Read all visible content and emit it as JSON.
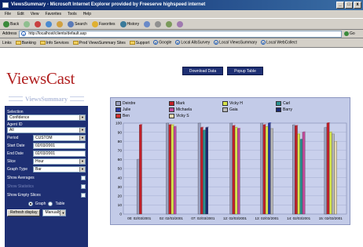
{
  "window": {
    "title": "ViewsSummary - Microsoft Internet Explorer provided by Freeserve highspeed internet",
    "controls": [
      "_",
      "□",
      "x"
    ]
  },
  "menubar": [
    "File",
    "Edit",
    "View",
    "Favorites",
    "Tools",
    "Help"
  ],
  "toolbar": {
    "back": "Back",
    "search": "Search",
    "favorites": "Favorites",
    "history": "History"
  },
  "addressbar": {
    "label": "Address",
    "url": "http://localhost/clients/default.asp",
    "go": "Go"
  },
  "linksbar": {
    "label": "Links",
    "items": [
      "Banking",
      "Info Services",
      "Prod ViewsSummary Sites",
      "Support",
      "Google",
      "Local AllsSurvey",
      "Local ViewsSummary",
      "Local WebCollect"
    ]
  },
  "brand": "ViewsCast",
  "sidebar_title": "ViewsSummary",
  "buttons": {
    "download": "Download Data",
    "popup": "Popup Table"
  },
  "controls": {
    "selection_label": "Selection",
    "selection_value": "Confidence",
    "agent_label": "Agent ID",
    "agent_value": "All",
    "period_label": "Period",
    "period_value": "CUSTOM",
    "start_label": "Start Date",
    "start_value": "02/03/2001",
    "end_label": "End Date",
    "end_value": "02/03/2001",
    "slice_label": "Slice",
    "slice_value": "Hour",
    "graph_type_label": "Graph Type",
    "graph_type_value": "Bar",
    "show_averages": "Show Averages",
    "show_muted": "Show Statistics",
    "show_empty": "Show Empty Slices",
    "radio_graph": "Graph",
    "radio_table": "Table",
    "refresh": "Refresh display",
    "manual": "Manually"
  },
  "chart_data": {
    "type": "bar",
    "ylim": [
      0,
      100
    ],
    "yticks": [
      0,
      10,
      20,
      30,
      40,
      50,
      60,
      70,
      80,
      90,
      100
    ],
    "categories": [
      "00: 02/03/2001",
      "02: 02/03/2001",
      "07: 02/03/2001",
      "12: 02/03/2001",
      "13: 02/03/2001",
      "14: 02/03/2001",
      "15: 02/03/2001"
    ],
    "series": [
      {
        "name": "Deirdre",
        "color": "#9aa0c0",
        "values": [
          60,
          100,
          100,
          100,
          100,
          98,
          95
        ]
      },
      {
        "name": "Mark",
        "color": "#c2202a",
        "values": [
          98,
          98,
          95,
          97,
          98,
          97,
          100
        ]
      },
      {
        "name": "Vicky H",
        "color": "#d8e44a",
        "values": [
          0,
          98,
          0,
          95,
          96,
          88,
          90
        ]
      },
      {
        "name": "Carl",
        "color": "#2a9090",
        "values": [
          0,
          0,
          92,
          0,
          0,
          82,
          0
        ]
      },
      {
        "name": "Julie",
        "color": "#2a3aa8",
        "values": [
          0,
          0,
          0,
          0,
          100,
          0,
          0
        ]
      },
      {
        "name": "Michaela",
        "color": "#c04a9a",
        "values": [
          0,
          96,
          0,
          94,
          0,
          90,
          0
        ]
      },
      {
        "name": "Gaia",
        "color": "#b8b8b8",
        "values": [
          0,
          0,
          0,
          0,
          94,
          0,
          88
        ]
      },
      {
        "name": "Barry",
        "color": "#1a2870",
        "values": [
          0,
          0,
          95,
          0,
          0,
          0,
          0
        ]
      },
      {
        "name": "Ben",
        "color": "#d23030",
        "values": [
          0,
          0,
          0,
          0,
          0,
          0,
          0
        ]
      },
      {
        "name": "Vicky S",
        "color": "#e6d8b0",
        "values": [
          0,
          0,
          0,
          0,
          0,
          0,
          80
        ]
      }
    ]
  }
}
